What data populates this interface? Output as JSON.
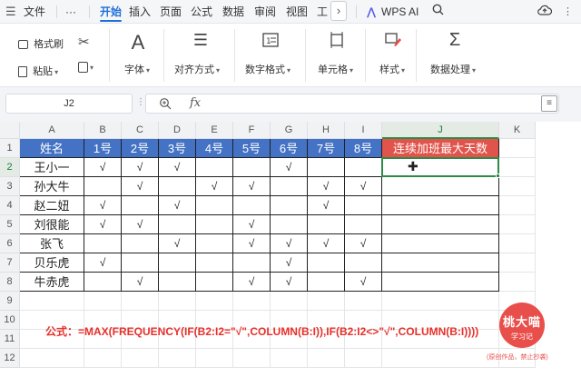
{
  "menubar": {
    "file_label": "文件",
    "more_label": "···",
    "tabs": [
      "开始",
      "插入",
      "页面",
      "公式",
      "数据",
      "审阅",
      "视图",
      "工"
    ],
    "chevron": "›",
    "wps_ai_label": "WPS AI"
  },
  "ribbon": {
    "format_painter": "格式刷",
    "paste": "粘贴",
    "font": "字体",
    "alignment": "对齐方式",
    "number_format": "数字格式",
    "cell": "单元格",
    "style": "样式",
    "data_processing": "数据处理"
  },
  "formula_bar": {
    "name_box": "J2",
    "fx_label": "fx",
    "value": ""
  },
  "sheet": {
    "col_headers": [
      "A",
      "B",
      "C",
      "D",
      "E",
      "F",
      "G",
      "H",
      "I",
      "J",
      "K"
    ],
    "row_headers": [
      "1",
      "2",
      "3",
      "4",
      "5",
      "6",
      "7",
      "8",
      "9",
      "10",
      "11",
      "12"
    ],
    "selected_cell": "J2",
    "table_header": {
      "name": "姓名",
      "days": [
        "1号",
        "2号",
        "3号",
        "4号",
        "5号",
        "6号",
        "7号",
        "8号"
      ],
      "result": "连续加班最大天数"
    },
    "rows": [
      {
        "name": "王小一",
        "marks": [
          "√",
          "√",
          "√",
          "",
          "",
          "√",
          "",
          ""
        ]
      },
      {
        "name": "孙大牛",
        "marks": [
          "",
          "√",
          "",
          "√",
          "√",
          "",
          "√",
          "√"
        ]
      },
      {
        "name": "赵二妞",
        "marks": [
          "√",
          "",
          "√",
          "",
          "",
          "",
          "√",
          ""
        ]
      },
      {
        "name": "刘很能",
        "marks": [
          "√",
          "√",
          "",
          "",
          "√",
          "",
          "",
          ""
        ]
      },
      {
        "name": "张飞",
        "marks": [
          "",
          "",
          "√",
          "",
          "√",
          "√",
          "√",
          "√"
        ]
      },
      {
        "name": "贝乐虎",
        "marks": [
          "√",
          "",
          "",
          "",
          "",
          "√",
          "",
          ""
        ]
      },
      {
        "name": "牛赤虎",
        "marks": [
          "",
          "√",
          "",
          "",
          "√",
          "√",
          "",
          "√"
        ]
      }
    ],
    "formula_note": "公式：=MAX(FREQUENCY(IF(B2:I2=\"√\",COLUMN(B:I)),IF(B2:I2<>\"√\",COLUMN(B:I))))"
  },
  "watermark": {
    "line1": "桃大喵",
    "line2": "学习记",
    "sub": "(原创作品，禁止抄袭)"
  },
  "colors": {
    "header_blue": "#4472c4",
    "header_red": "#e0544c",
    "accent_blue": "#1e6fd9",
    "selection_green": "#2e8b47",
    "formula_red": "#e8302a"
  }
}
